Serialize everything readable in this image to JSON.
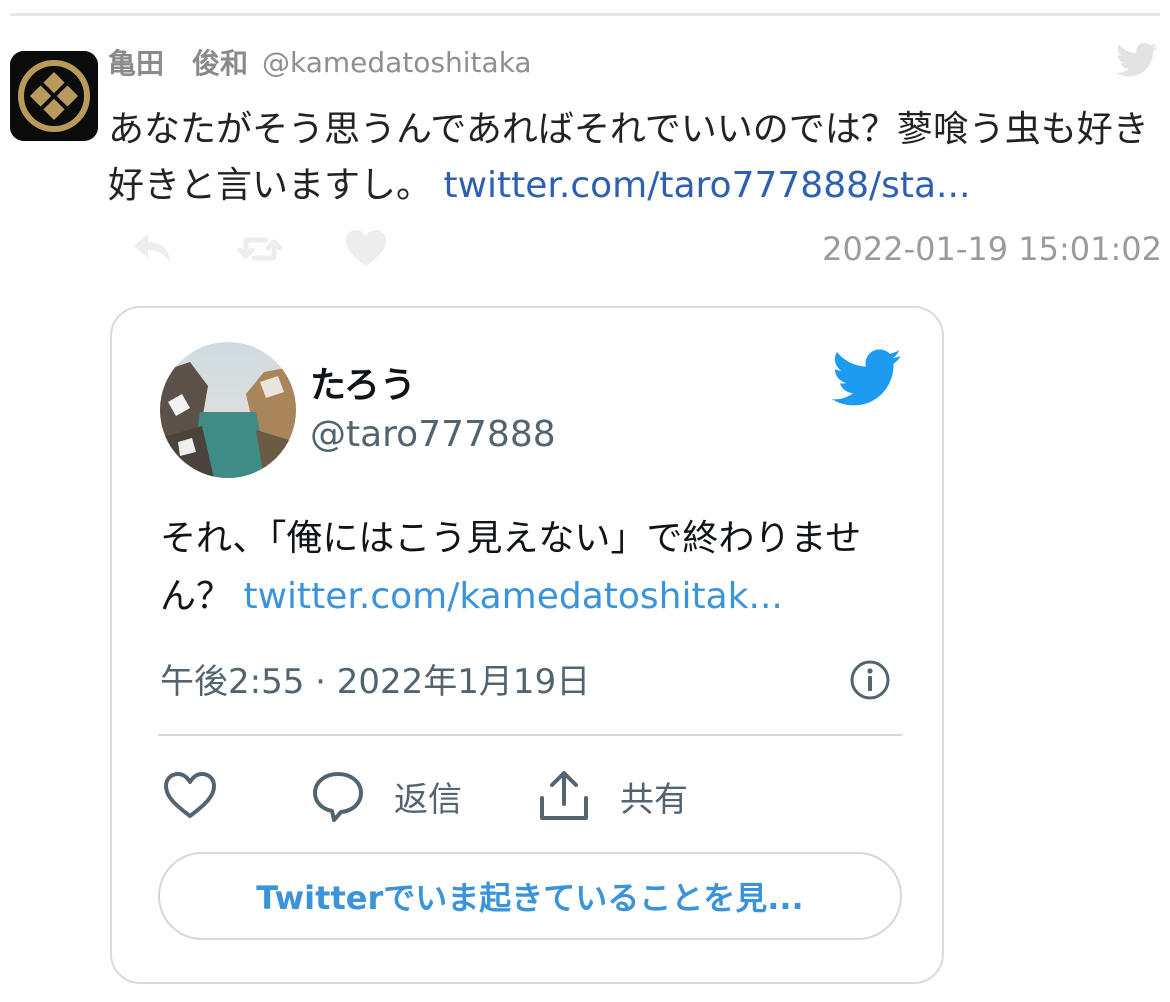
{
  "tweet": {
    "author_name": "亀田　俊和",
    "author_handle": "@kamedatoshitaka",
    "text": "あなたがそう思うんであればそれでいいのでは？蓼喰う虫も好き好きと言いますし。",
    "link": "twitter.com/taro777888/sta...",
    "timestamp": "2022-01-19 15:01:02",
    "icons": {
      "avatar": "family-crest-avatar",
      "service": "twitter-bird-icon",
      "reply": "reply-icon",
      "retweet": "retweet-icon",
      "like": "heart-icon"
    },
    "colors": {
      "link": "#2d60b2",
      "meta": "#9b9b9b",
      "crest_gold": "#b89a5a"
    }
  },
  "embed": {
    "author_name": "たろう",
    "author_handle": "@taro777888",
    "text": "それ、「俺にはこう見えない」で終わりません？",
    "link": "twitter.com/kamedatoshitak...",
    "timestamp": "午後2:55 · 2022年1月19日",
    "actions": {
      "reply_label": "返信",
      "share_label": "共有"
    },
    "cta_label": "Twitterでいま起きていることを見...",
    "icons": {
      "avatar": "landscape-avatar",
      "service": "twitter-bird-icon",
      "info": "info-icon",
      "like": "heart-outline-icon",
      "reply": "speech-bubble-icon",
      "share": "share-icon"
    },
    "colors": {
      "brand_blue": "#1d9bf0",
      "link": "#3b94d9",
      "border": "#cfd9de"
    }
  }
}
